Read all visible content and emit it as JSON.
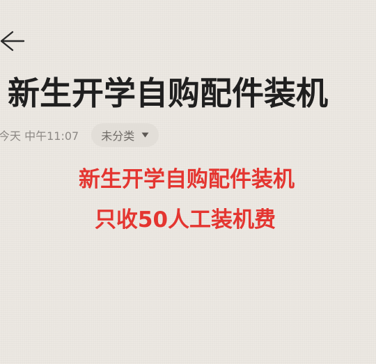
{
  "header": {
    "back_icon": "back-arrow-icon"
  },
  "note": {
    "title": "新生开学自购配件装机",
    "timestamp": "今天 中午11:07",
    "category": "未分类",
    "category_icon": "triangle-down-icon",
    "body_lines": [
      "新生开学自购配件装机",
      "只收50人工装机费"
    ],
    "body_color": "#e43530"
  }
}
